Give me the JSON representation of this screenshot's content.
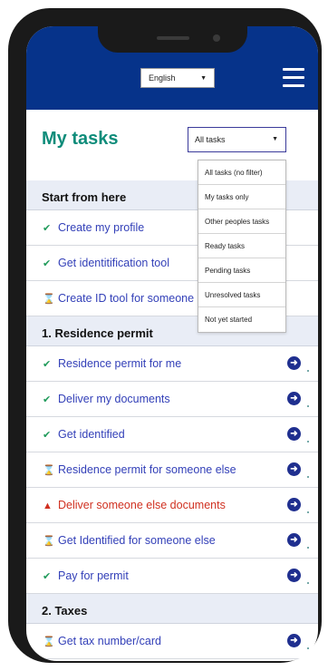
{
  "header": {
    "language": "English",
    "menu_icon": "hamburger-icon"
  },
  "page": {
    "title": "My tasks",
    "filter_selected": "All tasks",
    "filter_options": [
      "All tasks (no filter)",
      "My tasks only",
      "Other peoples tasks",
      "Ready tasks",
      "Pending tasks",
      "Unresolved tasks",
      "Not yet started"
    ]
  },
  "sections": [
    {
      "title": "Start from here",
      "tasks": [
        {
          "label": "Create my profile",
          "status": "done",
          "icon": "check-circle-icon"
        },
        {
          "label": "Get identitification tool",
          "status": "done",
          "icon": "check-circle-icon"
        },
        {
          "label": "Create ID tool for someone else",
          "status": "pending",
          "icon": "hourglass-icon"
        }
      ]
    },
    {
      "title": "1. Residence permit",
      "tasks": [
        {
          "label": "Residence permit for me",
          "status": "done",
          "icon": "check-circle-icon"
        },
        {
          "label": "Deliver my documents",
          "status": "done",
          "icon": "check-circle-icon"
        },
        {
          "label": "Get identified",
          "status": "done",
          "icon": "check-circle-icon"
        },
        {
          "label": "Residence permit for someone else",
          "status": "pending",
          "icon": "hourglass-icon"
        },
        {
          "label": "Deliver someone else documents",
          "status": "warning",
          "icon": "warning-triangle-icon"
        },
        {
          "label": "Get Identified for someone else",
          "status": "pending",
          "icon": "hourglass-icon"
        },
        {
          "label": "Pay for permit",
          "status": "done",
          "icon": "check-circle-icon"
        }
      ]
    },
    {
      "title": "2. Taxes",
      "tasks": [
        {
          "label": "Get tax number/card",
          "status": "pending",
          "icon": "hourglass-icon"
        }
      ]
    }
  ],
  "colors": {
    "header_bg": "#06338a",
    "title": "#0e8c7a",
    "link": "#3340b8",
    "done": "#1f9a5a",
    "pending": "#e08a10",
    "warning": "#d03020"
  }
}
